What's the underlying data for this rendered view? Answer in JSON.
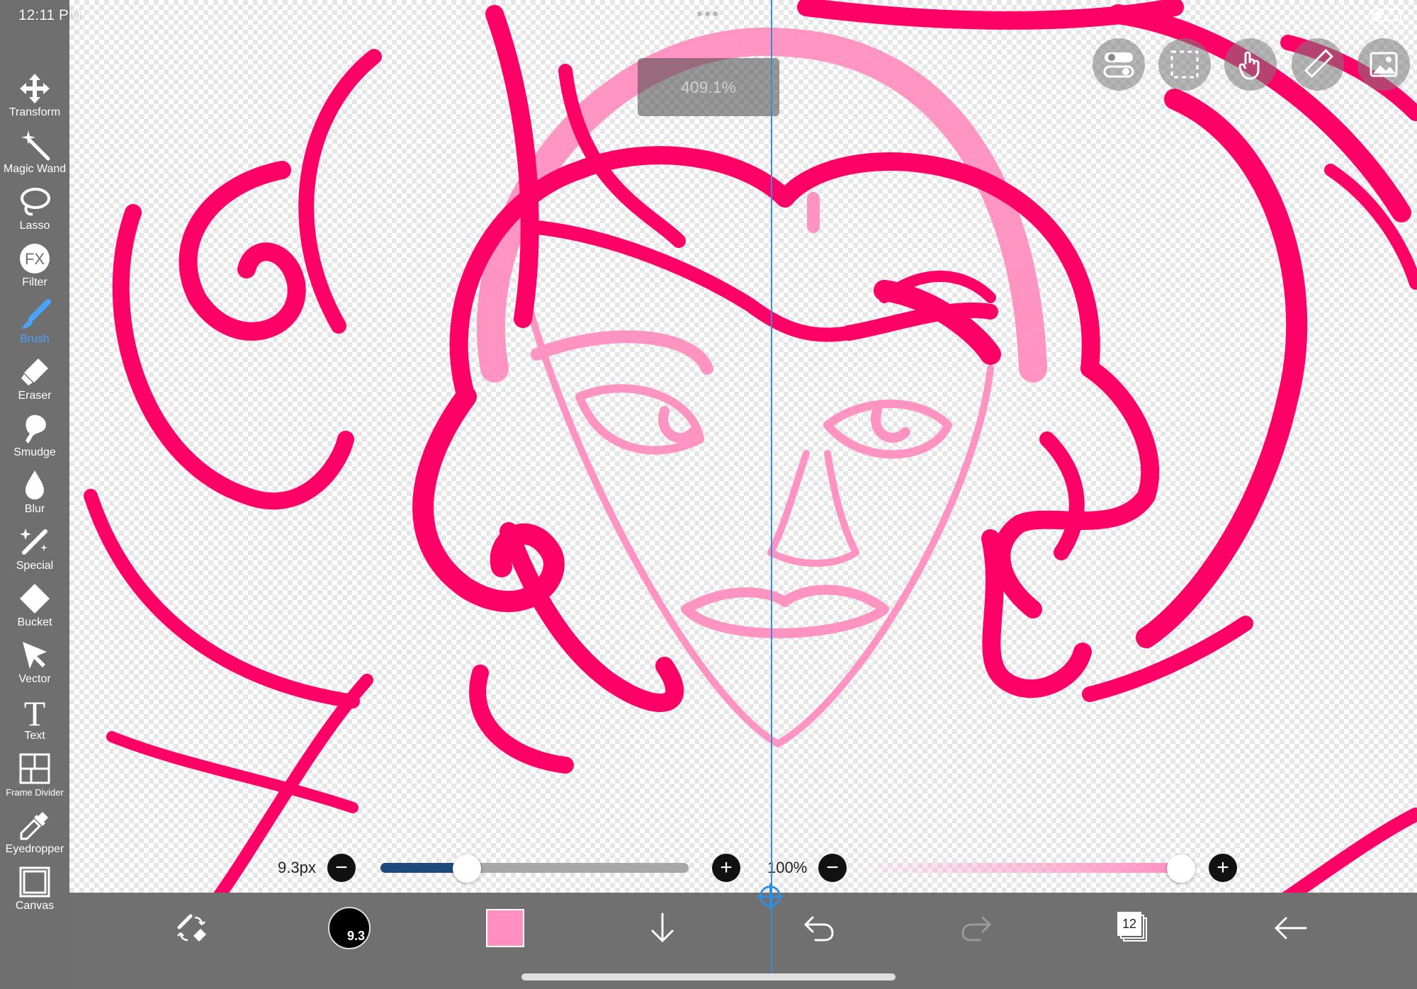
{
  "status_bar": {
    "time": "12:11 PM"
  },
  "zoom_indicator": {
    "value": "409.1%"
  },
  "tools": [
    {
      "id": "transform",
      "label": "Transform",
      "icon": "move-arrows-icon",
      "active": false
    },
    {
      "id": "magic-wand",
      "label": "Magic Wand",
      "icon": "magic-wand-icon",
      "active": false
    },
    {
      "id": "lasso",
      "label": "Lasso",
      "icon": "lasso-icon",
      "active": false
    },
    {
      "id": "filter",
      "label": "Filter",
      "icon": "fx-icon",
      "active": false
    },
    {
      "id": "brush",
      "label": "Brush",
      "icon": "brush-icon",
      "active": true
    },
    {
      "id": "eraser",
      "label": "Eraser",
      "icon": "eraser-icon",
      "active": false
    },
    {
      "id": "smudge",
      "label": "Smudge",
      "icon": "smudge-icon",
      "active": false
    },
    {
      "id": "blur",
      "label": "Blur",
      "icon": "droplet-icon",
      "active": false
    },
    {
      "id": "special",
      "label": "Special",
      "icon": "special-wand-icon",
      "active": false
    },
    {
      "id": "bucket",
      "label": "Bucket",
      "icon": "bucket-icon",
      "active": false
    },
    {
      "id": "vector",
      "label": "Vector",
      "icon": "cursor-arrow-icon",
      "active": false
    },
    {
      "id": "text",
      "label": "Text",
      "icon": "text-t-icon",
      "active": false
    },
    {
      "id": "frame-divider",
      "label": "Frame Divider",
      "icon": "frame-divider-icon",
      "active": false
    },
    {
      "id": "eyedropper",
      "label": "Eyedropper",
      "icon": "eyedropper-icon",
      "active": false
    },
    {
      "id": "canvas",
      "label": "Canvas",
      "icon": "canvas-square-icon",
      "active": false
    }
  ],
  "top_buttons": [
    {
      "id": "toggle",
      "icon": "toggle-switches-icon"
    },
    {
      "id": "selection",
      "icon": "dashed-selection-icon"
    },
    {
      "id": "touch",
      "icon": "hand-touch-icon"
    },
    {
      "id": "ruler",
      "icon": "ruler-icon"
    },
    {
      "id": "reference",
      "icon": "image-reference-icon"
    }
  ],
  "brush_size": {
    "label": "9.3px",
    "level": 0.28
  },
  "opacity": {
    "label": "100%",
    "level": 1.0
  },
  "bottom_bar": {
    "brush_size_badge": "9.3",
    "color": "#ff8fc0",
    "layer_count": "12"
  },
  "colors": {
    "accent": "#4aa3ff",
    "ink": "#ff0066",
    "sketch": "#ff8fc0",
    "guide": "#2f8fe0"
  }
}
